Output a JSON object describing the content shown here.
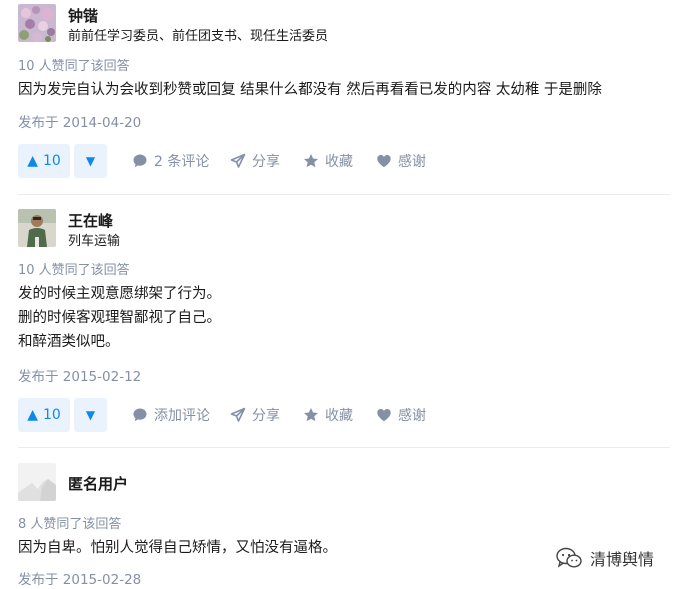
{
  "answers": [
    {
      "author": "钟锴",
      "bio": "前前任学习委员、前任团支书、现任生活委员",
      "votes_text": "10 人赞同了该回答",
      "content": [
        "因为发完自认为会收到秒赞或回复 结果什么都没有 然后再看看已发的内容 太幼稚 于是删除"
      ],
      "date": "发布于 2014-04-20",
      "vote_count": "10",
      "comment_label": "2 条评论",
      "share_label": "分享",
      "collect_label": "收藏",
      "thanks_label": "感谢"
    },
    {
      "author": "王在峰",
      "bio": "列车运输",
      "votes_text": "10 人赞同了该回答",
      "content": [
        "发的时候主观意愿绑架了行为。",
        "删的时候客观理智鄙视了自己。",
        "和醉酒类似吧。"
      ],
      "date": "发布于 2015-02-12",
      "vote_count": "10",
      "comment_label": "添加评论",
      "share_label": "分享",
      "collect_label": "收藏",
      "thanks_label": "感谢"
    },
    {
      "author": "匿名用户",
      "bio": "",
      "votes_text": "8 人赞同了该回答",
      "content": [
        "因为自卑。怕别人觉得自己矫情，又怕没有逼格。"
      ],
      "date": "发布于 2015-02-28"
    }
  ],
  "watermark": {
    "text": "清博舆情",
    "icon": "wechat-icon"
  },
  "colors": {
    "accent": "#0f88eb",
    "accent_bg": "#eaf3fd",
    "meta": "#8590a6",
    "divider": "#ebebeb"
  }
}
